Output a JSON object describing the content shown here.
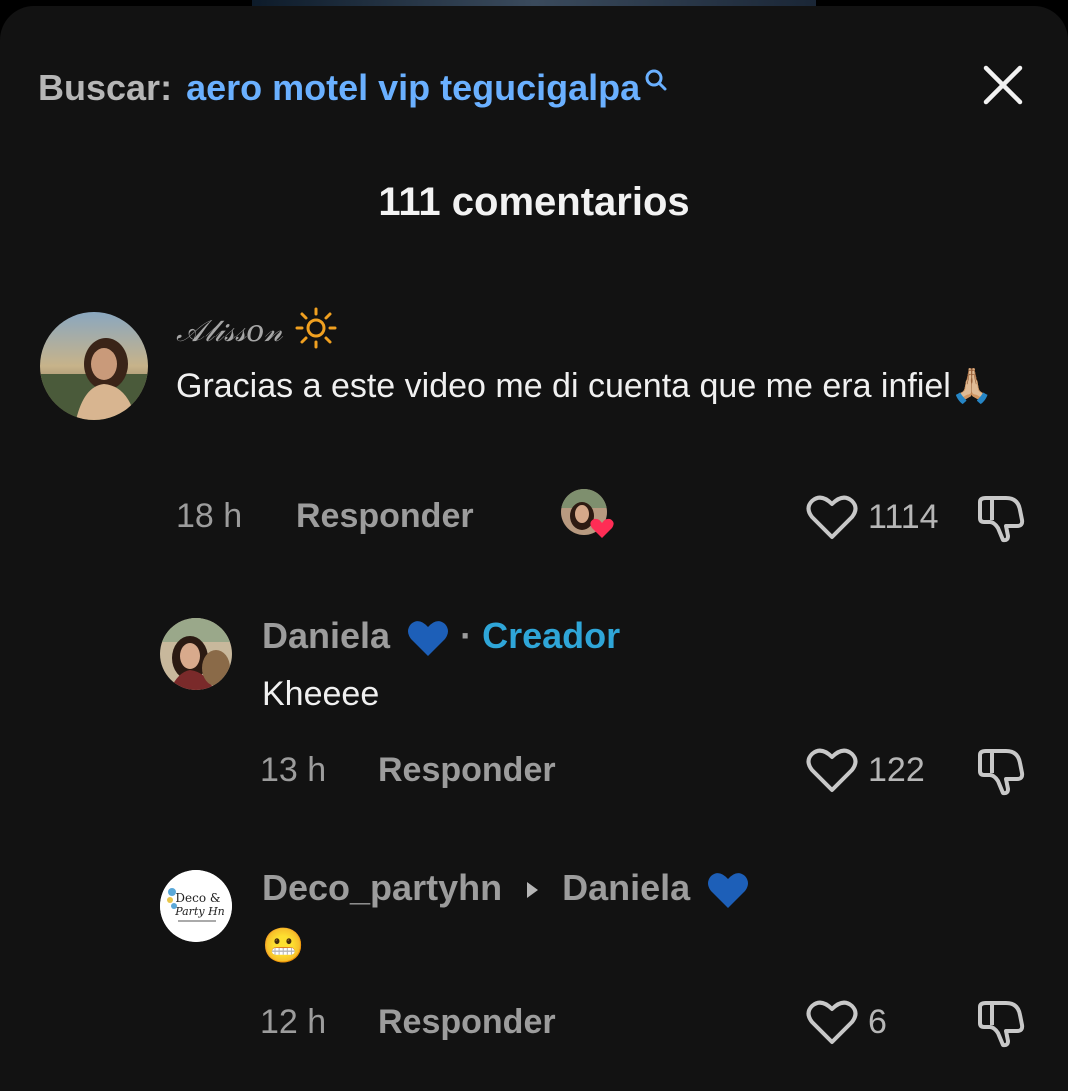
{
  "search": {
    "label": "Buscar:",
    "query": "aero motel vip tegucigalpa"
  },
  "header": {
    "title": "111 comentarios"
  },
  "comments": [
    {
      "username": "𝒜𝓁𝒾𝓈𝓈𝑜𝓃",
      "text": "Gracias a este video me di cuenta que me era infiel🙏🏼",
      "time": "18 h",
      "reply_label": "Responder",
      "likes": "1114"
    },
    {
      "username": "Daniela",
      "creator_label": "Creador",
      "text": "Kheeee",
      "time": "13 h",
      "reply_label": "Responder",
      "likes": "122"
    },
    {
      "username": "Deco_partyhn",
      "reply_to": "Daniela",
      "text": "😬",
      "time": "12 h",
      "reply_label": "Responder",
      "likes": "6",
      "avatar_logo": "Deco & Party Hn"
    }
  ],
  "colors": {
    "accent_blue": "#6ab0ff",
    "creator": "#2fa6d8",
    "background": "#121212"
  }
}
